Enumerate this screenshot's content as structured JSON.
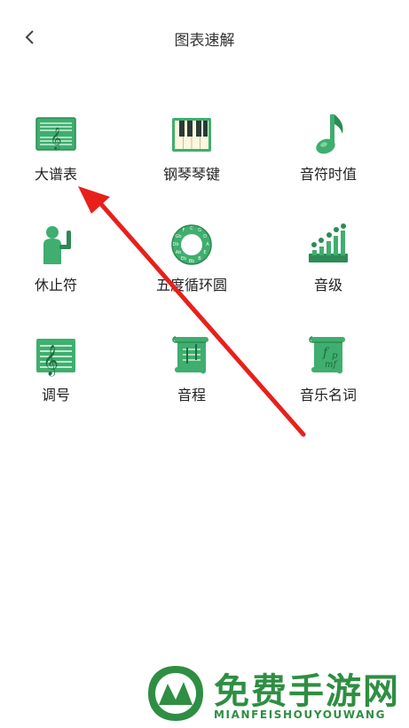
{
  "header": {
    "back_icon": "chevron-left-icon",
    "title": "图表速解"
  },
  "items": [
    {
      "label": "大谱表",
      "icon": "staff-icon"
    },
    {
      "label": "钢琴琴键",
      "icon": "piano-keys-icon"
    },
    {
      "label": "音符时值",
      "icon": "music-note-icon"
    },
    {
      "label": "休止符",
      "icon": "rest-figure-icon"
    },
    {
      "label": "五度循环圆",
      "icon": "circle-of-fifths-icon"
    },
    {
      "label": "音级",
      "icon": "scale-steps-icon"
    },
    {
      "label": "调号",
      "icon": "key-signature-icon"
    },
    {
      "label": "音程",
      "icon": "interval-scroll-icon"
    },
    {
      "label": "音乐名词",
      "icon": "music-terms-scroll-icon"
    }
  ],
  "colors": {
    "icon_green": "#3fae6e",
    "icon_dark": "#2d8a55",
    "arrow_red": "#e8201a",
    "watermark_green": "#2f8e43"
  },
  "watermark": {
    "name": "免费手游网",
    "sub": "MIANFEISHOUYOUWANG"
  }
}
